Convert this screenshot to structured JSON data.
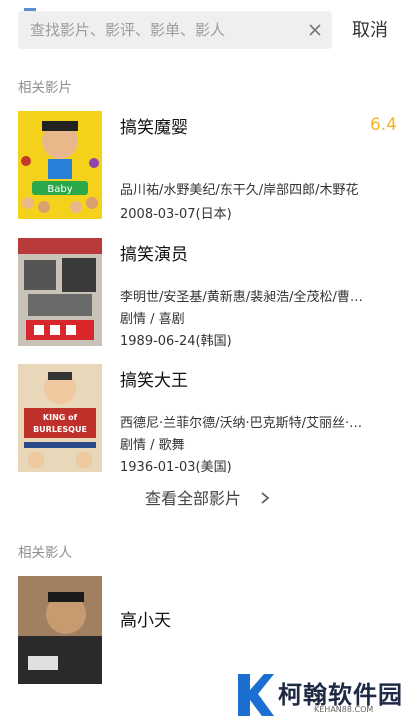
{
  "search": {
    "placeholder": "查找影片、影评、影单、影人",
    "value": "",
    "clear_icon": "close-icon",
    "cancel_label": "取消"
  },
  "sections": {
    "movies_title": "相关影片",
    "people_title": "相关影人"
  },
  "movies": [
    {
      "title": "搞笑魔婴",
      "rating": "6.4",
      "cast": "品川祐/水野美纪/东干久/岸部四郎/木野花",
      "genre": "",
      "date": "2008-03-07(日本)"
    },
    {
      "title": "搞笑演员",
      "rating": "",
      "cast": "李明世/安圣基/黄新惠/裴昶浩/全茂松/曹…",
      "genre": "剧情 / 喜剧",
      "date": "1989-06-24(韩国)"
    },
    {
      "title": "搞笑大王",
      "rating": "",
      "cast": "西德尼·兰菲尔德/沃纳·巴克斯特/艾丽丝·…",
      "genre": "剧情 / 歌舞",
      "date": "1936-01-03(美国)"
    }
  ],
  "see_all": {
    "label": "查看全部影片",
    "icon": "chevron-right-icon"
  },
  "people": [
    {
      "name": "高小天"
    }
  ],
  "watermark": {
    "name": "柯翰软件园",
    "url": "KEHAN88.COM",
    "logo_letter": "K"
  },
  "colors": {
    "rating": "#f5b324",
    "search_bg": "#efefef",
    "section_title": "#8f8f8f",
    "watermark_blue": "#1a6fd1"
  }
}
